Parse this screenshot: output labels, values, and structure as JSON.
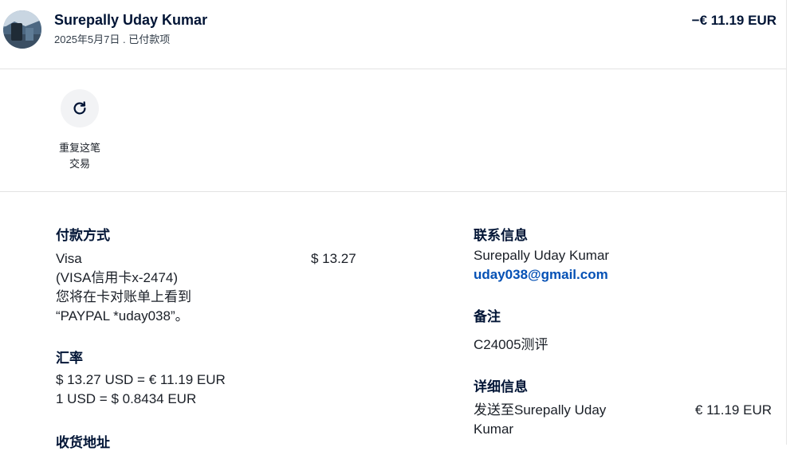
{
  "header": {
    "merchant_name": "Surepally Uday Kumar",
    "subtitle": "2025年5月7日 . 已付款项",
    "amount": "−€ 11.19 EUR"
  },
  "actions": {
    "repeat_label_line1": "重复这笔",
    "repeat_label_line2": "交易",
    "repeat_icon": "refresh-icon"
  },
  "payment": {
    "title": "付款方式",
    "method": "Visa",
    "card": "(VISA信用卡x-2474)",
    "statement_line1": "您将在卡对账单上看到",
    "statement_line2": "“PAYPAL *uday038”。",
    "amount": "$ 13.27"
  },
  "exchange": {
    "title": "汇率",
    "line1": "$ 13.27 USD = € 11.19 EUR",
    "line2": "1 USD = $ 0.8434 EUR"
  },
  "shipping": {
    "title": "收货地址"
  },
  "contact": {
    "title": "联系信息",
    "name": "Surepally Uday Kumar",
    "email": "uday038@gmail.com"
  },
  "notes": {
    "title": "备注",
    "text": "C24005测评"
  },
  "details": {
    "title": "详细信息",
    "sent_to_line1": "发送至Surepally Uday",
    "sent_to_line2": "Kumar",
    "amount": "€ 11.19 EUR"
  },
  "colors": {
    "text_dark": "#001435",
    "link_blue": "#0551b5",
    "divider": "#e3e3e3",
    "icon_circle_bg": "#f2f3f5"
  }
}
